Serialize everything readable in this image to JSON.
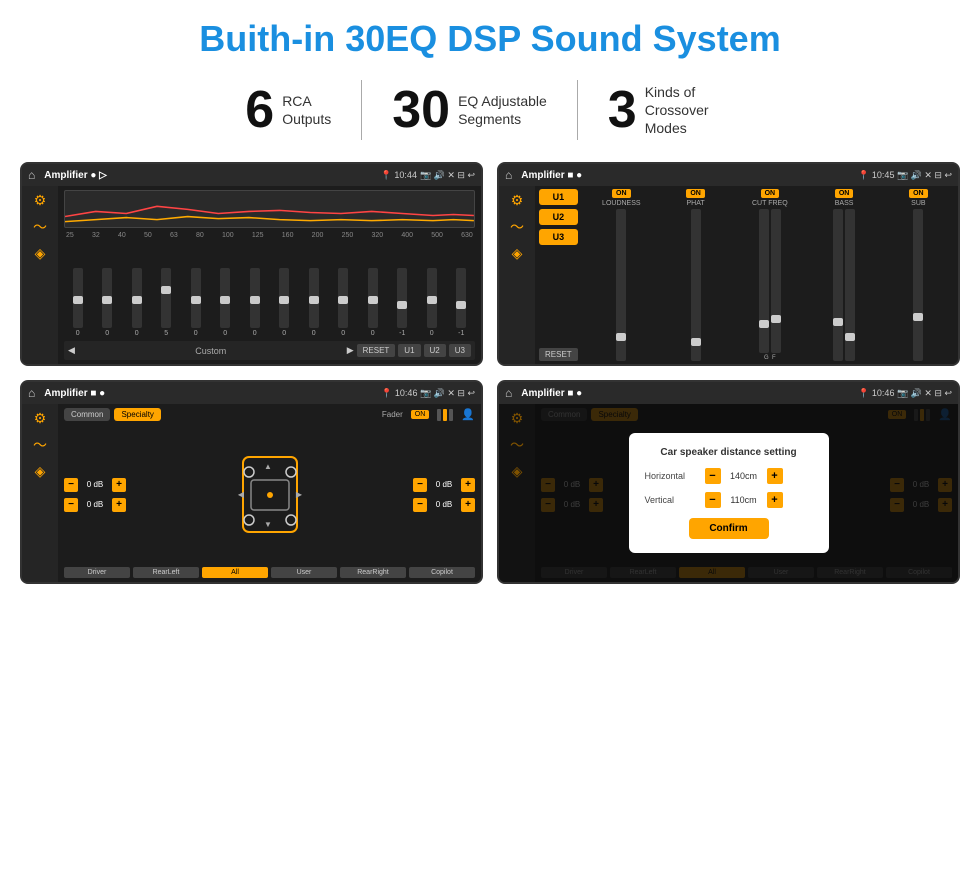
{
  "title": "Buith-in 30EQ DSP Sound System",
  "stats": [
    {
      "number": "6",
      "label": "RCA\nOutputs"
    },
    {
      "number": "30",
      "label": "EQ Adjustable\nSegments"
    },
    {
      "number": "3",
      "label": "Kinds of\nCrossover Modes"
    }
  ],
  "screens": [
    {
      "id": "eq-screen",
      "statusBar": {
        "title": "Amplifier",
        "time": "10:44"
      },
      "freqLabels": [
        "25",
        "32",
        "40",
        "50",
        "63",
        "80",
        "100",
        "125",
        "160",
        "200",
        "250",
        "320",
        "400",
        "500",
        "630"
      ],
      "sliderValues": [
        "0",
        "0",
        "0",
        "5",
        "0",
        "0",
        "0",
        "0",
        "0",
        "0",
        "0",
        "-1",
        "0",
        "-1"
      ],
      "bottomBtns": [
        "Custom",
        "RESET",
        "U1",
        "U2",
        "U3"
      ]
    },
    {
      "id": "crossover-screen",
      "statusBar": {
        "title": "Amplifier",
        "time": "10:45"
      },
      "uBtns": [
        "U1",
        "U2",
        "U3"
      ],
      "cols": [
        {
          "label": "LOUDNESS",
          "on": true
        },
        {
          "label": "PHAT",
          "on": true
        },
        {
          "label": "CUT FREQ",
          "on": true
        },
        {
          "label": "BASS",
          "on": true
        },
        {
          "label": "SUB",
          "on": true
        }
      ]
    },
    {
      "id": "fader-screen",
      "statusBar": {
        "title": "Amplifier",
        "time": "10:46"
      },
      "tabs": [
        "Common",
        "Specialty"
      ],
      "activeTab": 1,
      "faderOn": true,
      "dbValues": [
        "0 dB",
        "0 dB",
        "0 dB",
        "0 dB"
      ],
      "bottomBtns": [
        "Driver",
        "RearLeft",
        "All",
        "User",
        "RearRight",
        "Copilot"
      ]
    },
    {
      "id": "dialog-screen",
      "statusBar": {
        "title": "Amplifier",
        "time": "10:46"
      },
      "tabs": [
        "Common",
        "Specialty"
      ],
      "activeTab": 1,
      "dialog": {
        "title": "Car speaker distance setting",
        "rows": [
          {
            "label": "Horizontal",
            "value": "140cm"
          },
          {
            "label": "Vertical",
            "value": "110cm"
          }
        ],
        "confirmLabel": "Confirm"
      },
      "bottomBtns": [
        "Driver",
        "RearLeft",
        "All",
        "User",
        "RearRight",
        "Copilot"
      ]
    }
  ]
}
